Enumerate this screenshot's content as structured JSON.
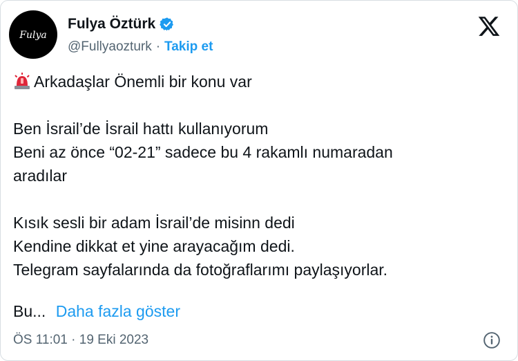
{
  "author": {
    "display_name": "Fulya Öztürk",
    "handle": "@Fullyaozturk",
    "separator": "·",
    "follow_label": "Takip et",
    "avatar_text": "Fulya"
  },
  "tweet": {
    "lines": [
      "Arkadaşlar Önemli bir konu var",
      "",
      "Ben İsrail’de İsrail hattı kullanıyorum",
      "Beni az önce “02-21” sadece bu 4 rakamlı numaradan",
      "aradılar",
      "",
      "Kısık sesli bir adam İsrail’de misinn dedi",
      "Kendine dikkat et yine arayacağım dedi.",
      "Telegram sayfalarında da fotoğraflarımı paylaşıyorlar."
    ],
    "truncated_prefix": "Bu...",
    "show_more_label": "Daha fazla göster",
    "timestamp": "ÖS 11:01 · 19 Eki 2023"
  },
  "icons": {
    "verified": "verified-badge-icon",
    "platform": "x-logo-icon",
    "alert": "police-light-emoji-icon",
    "info": "info-icon"
  },
  "colors": {
    "accent": "#1d9bf0",
    "text": "#0f1419",
    "muted": "#536471"
  }
}
